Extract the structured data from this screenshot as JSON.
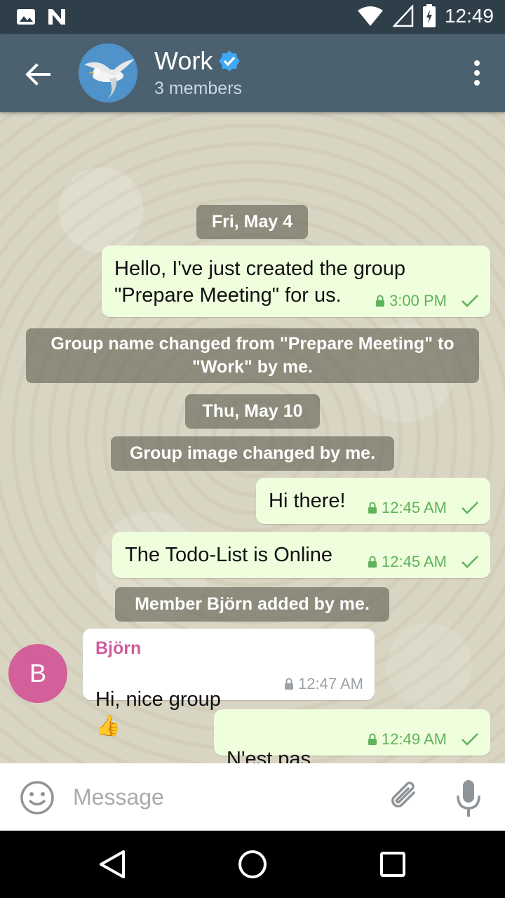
{
  "status_bar": {
    "time": "12:49"
  },
  "header": {
    "title": "Work",
    "subtitle": "3 members"
  },
  "messages": {
    "date1": "Fri, May 4",
    "m1_text": "Hello, I've just created the group\n\"Prepare Meeting\" for us.",
    "m1_time": "3:00 PM",
    "sys1": "Group name changed from \"Prepare Meeting\" to\n\"Work\" by me.",
    "date2": "Thu, May 10",
    "sys2": "Group image changed by me.",
    "m2_text": "Hi there!",
    "m2_time": "12:45 AM",
    "m3_text": "The Todo-List is Online",
    "m3_time": "12:45 AM",
    "sys3": "Member Björn added by me.",
    "m4_sender": "Björn",
    "m4_avatar_letter": "B",
    "m4_text": "Hi, nice group",
    "m4_emoji": "👍",
    "m4_time": "12:47 AM",
    "m5_text": "N'est pas",
    "m5_emoji": "😎",
    "m5_time": "12:49 AM"
  },
  "input": {
    "placeholder": "Message"
  },
  "colors": {
    "toolbar": "#4b6170",
    "outgoing_bubble": "#effedd",
    "incoming_bubble": "#ffffff",
    "sender_name": "#d15c9c",
    "verified_badge": "#3fa9f5"
  }
}
